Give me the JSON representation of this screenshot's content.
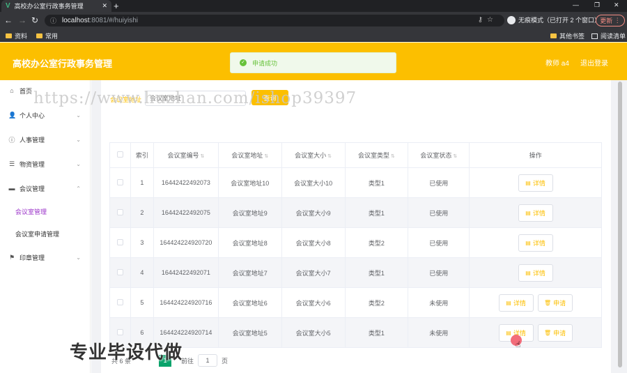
{
  "browser": {
    "tab_title": "高校办公室行政事务管理",
    "url_host": "localhost",
    "url_path": ":8081/#/huiyishi",
    "incognito_label": "无痕模式（已打开 2 个窗口）",
    "update_label": "更新",
    "bookmarks": [
      "资料",
      "常用"
    ],
    "bookmarks_right": [
      "其他书签",
      "阅读清单"
    ]
  },
  "header": {
    "title": "高校办公室行政事务管理",
    "user": "教师 a4",
    "logout": "退出登录"
  },
  "toast": {
    "message": "申请成功"
  },
  "sidebar": {
    "items": [
      {
        "label": "首页",
        "icon": "home-icon"
      },
      {
        "label": "个人中心",
        "icon": "user-icon"
      },
      {
        "label": "人事管理",
        "icon": "info-icon"
      },
      {
        "label": "物资管理",
        "icon": "list-icon"
      },
      {
        "label": "会议管理",
        "icon": "monitor-icon"
      },
      {
        "label": "印章管理",
        "icon": "flag-icon"
      }
    ],
    "submenu": [
      "会议室管理",
      "会议室申请管理"
    ]
  },
  "search": {
    "label": "会议室地址",
    "placeholder": "会议室地址",
    "button": "查询"
  },
  "table": {
    "headers": [
      "索引",
      "会议室编号",
      "会议室地址",
      "会议室大小",
      "会议室类型",
      "会议室状态",
      "操作"
    ],
    "rows": [
      {
        "index": "1",
        "code": "16442422492073",
        "address": "会议室地址10",
        "size": "会议室大小10",
        "type": "类型1",
        "status": "已使用"
      },
      {
        "index": "2",
        "code": "16442422492075",
        "address": "会议室地址9",
        "size": "会议室大小9",
        "type": "类型1",
        "status": "已使用"
      },
      {
        "index": "3",
        "code": "164424224920720",
        "address": "会议室地址8",
        "size": "会议室大小8",
        "type": "类型2",
        "status": "已使用"
      },
      {
        "index": "4",
        "code": "16442422492071",
        "address": "会议室地址7",
        "size": "会议室大小7",
        "type": "类型1",
        "status": "已使用"
      },
      {
        "index": "5",
        "code": "164424224920716",
        "address": "会议室地址6",
        "size": "会议室大小6",
        "type": "类型2",
        "status": "未使用"
      },
      {
        "index": "6",
        "code": "164424224920714",
        "address": "会议室地址5",
        "size": "会议室大小5",
        "type": "类型1",
        "status": "未使用"
      }
    ],
    "detail_label": "详情",
    "apply_label": "申请"
  },
  "pager": {
    "total": "共 6 条",
    "page": "1",
    "goto_prefix": "前往",
    "goto_value": "1",
    "goto_suffix": "页"
  },
  "watermark": "https://www.huzhan.com/ishop39397",
  "overlay": "专业毕设代做",
  "colors": {
    "brand": "#fcbf00",
    "success": "#67c23a",
    "active_menu": "#9b34c9"
  }
}
